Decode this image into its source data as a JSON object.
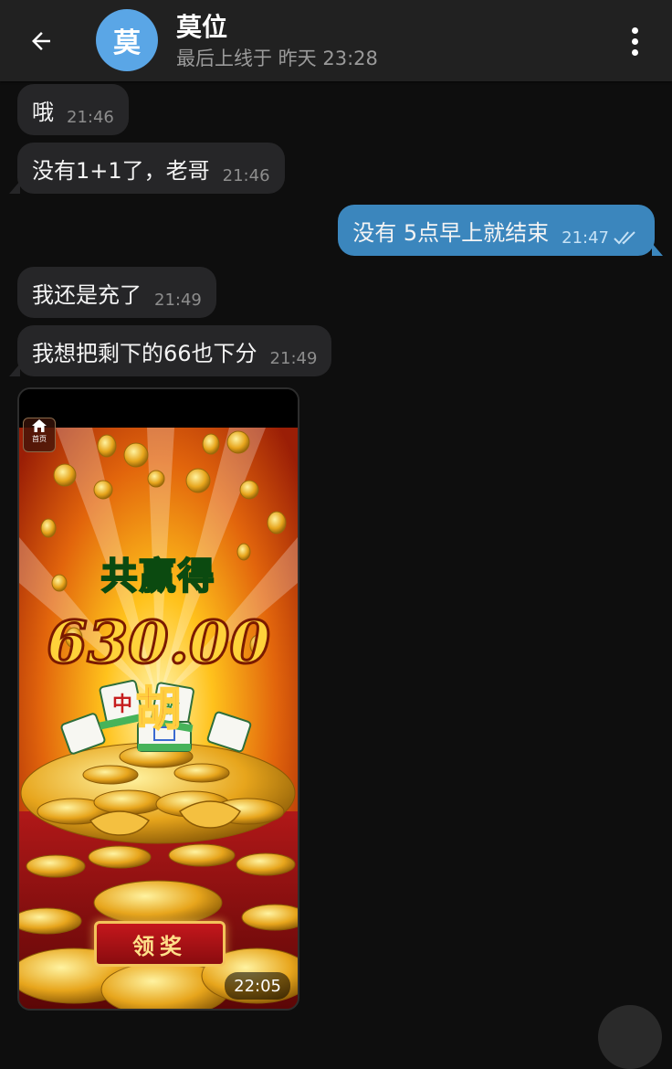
{
  "header": {
    "avatar_letter": "莫",
    "contact_name": "莫位",
    "last_seen": "最后上线于 昨天 23:28"
  },
  "messages": [
    {
      "text": "哦",
      "time": "21:46",
      "direction": "incoming"
    },
    {
      "text": "没有1+1了，老哥",
      "time": "21:46",
      "direction": "incoming"
    },
    {
      "text": "没有 5点早上就结束",
      "time": "21:47",
      "direction": "outgoing",
      "status": "read"
    },
    {
      "text": "我还是充了",
      "time": "21:49",
      "direction": "incoming"
    },
    {
      "text": "我想把剩下的66也下分",
      "time": "21:49",
      "direction": "incoming"
    },
    {
      "type": "photo",
      "time": "22:05",
      "direction": "incoming",
      "photo": {
        "home_label": "首页",
        "title": "共赢得",
        "amount": "630.00",
        "char": "胡",
        "button_label": "领奖"
      }
    }
  ],
  "colors": {
    "background": "#0e0e0e",
    "header": "#212121",
    "incoming_bubble": "#262628",
    "outgoing_bubble": "#3b86bd",
    "avatar": "#5aa6e6"
  }
}
